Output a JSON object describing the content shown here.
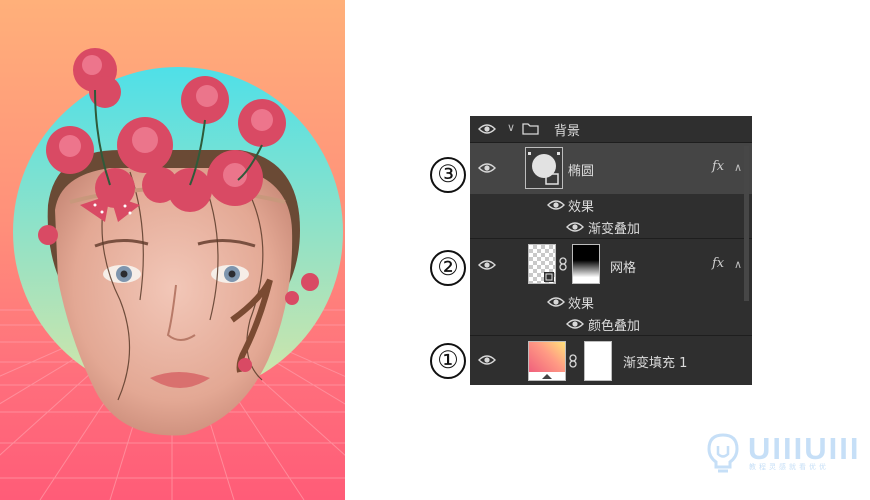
{
  "layers_panel": {
    "group_name": "背景",
    "rows": [
      {
        "name": "椭圆",
        "has_fx": true
      },
      {
        "name": "网格",
        "has_fx": true
      },
      {
        "name": "渐变填充 1",
        "has_fx": false
      }
    ],
    "effects_label": "效果",
    "ellipse_effect": "渐变叠加",
    "grid_effect": "颜色叠加",
    "fx_symbol": "fx"
  },
  "markers": [
    "③",
    "②",
    "①"
  ],
  "watermark": {
    "text": "UIIIUIII",
    "subtitle": "教程灵感就看优优",
    "color": "#c6dff7"
  },
  "colors": {
    "panel_bg": "#2f2f2f",
    "selected_row": "#454545",
    "poster_gradient_top": "#ffb07a",
    "poster_gradient_bottom": "#ff5c78"
  }
}
